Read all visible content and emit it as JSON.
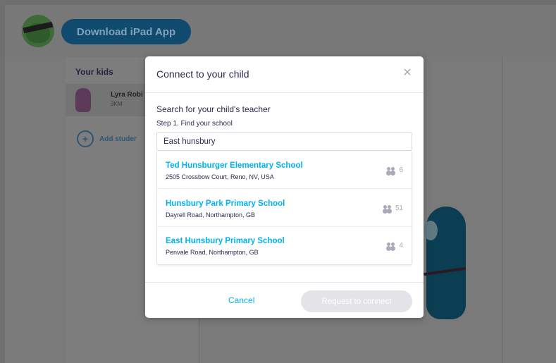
{
  "topbar": {
    "download_label": "Download iPad App"
  },
  "sidebar": {
    "title": "Your kids",
    "kids": [
      {
        "name": "Lyra Robi",
        "code": "3KM"
      }
    ],
    "add_label": "Add studer",
    "add_symbol": "+"
  },
  "modal": {
    "title": "Connect to your child",
    "close_symbol": "×",
    "search_heading": "Search for your child's teacher",
    "step_label": "Step 1. Find your school",
    "search_value": "East hunsbury",
    "results": [
      {
        "name": "Ted Hunsburger Elementary School",
        "address": "2505 Crossbow Court, Reno, NV, USA",
        "count": "6"
      },
      {
        "name": "Hunsbury Park Primary School",
        "address": "Dayrell Road, Northampton, GB",
        "count": "51"
      },
      {
        "name": "East Hunsbury Primary School",
        "address": "Penvale Road, Northampton, GB",
        "count": "4"
      }
    ],
    "cancel_label": "Cancel",
    "request_label": "Request to connect"
  },
  "colors": {
    "accent": "#00b2f0",
    "text_primary": "#2c2a50",
    "overlay": "#6f6f6f",
    "disabled_button": "#e3e3e8"
  }
}
